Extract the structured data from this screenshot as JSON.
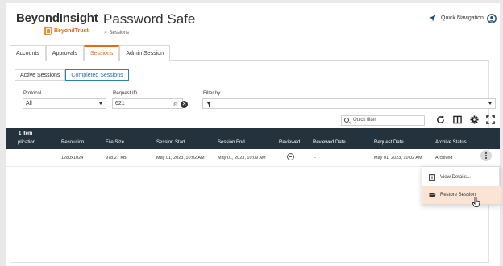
{
  "header": {
    "brand": "BeyondInsight",
    "brand_sub": "BeyondTrust",
    "app_title": "Password Safe",
    "breadcrumb_arrow": ">",
    "breadcrumb": "Sessions",
    "quick_nav": "Quick Navigation"
  },
  "tabs": [
    {
      "label": "Accounts",
      "active": false
    },
    {
      "label": "Approvals",
      "active": false
    },
    {
      "label": "Sessions",
      "active": true
    },
    {
      "label": "Admin Session",
      "active": false
    }
  ],
  "subtabs": [
    {
      "label": "Active Sessions",
      "active": false
    },
    {
      "label": "Completed Sessions",
      "active": true
    }
  ],
  "filters": {
    "protocol_label": "Protocol",
    "protocol_value": "All",
    "request_id_label": "Request ID",
    "request_id_value": "621",
    "filter_by_label": "Filter by"
  },
  "toolbar": {
    "quick_filter_placeholder": "Quick filter"
  },
  "grid": {
    "count": "1 item",
    "columns": [
      "plication",
      "Resolution",
      "File Size",
      "Session Start",
      "Session End",
      "Reviewed",
      "Reviewed Date",
      "Request Date",
      "Archive Status"
    ],
    "row": {
      "resolution": "1280x1024",
      "file_size": "978.27 KB",
      "session_start": "May 01, 2023, 10:02 AM",
      "session_end": "May 01, 2023, 10:09 AM",
      "reviewed_date": "-",
      "request_date": "May 01, 2023, 10:02 AM",
      "archive_status": "Archived"
    }
  },
  "context_menu": {
    "view_details": "View Details...",
    "restore_session": "Restore Session"
  },
  "colors": {
    "accent": "#e0691a",
    "grid_header": "#24323d",
    "nav_icon": "#1f4e79",
    "menu_hover": "#fbe4d4"
  }
}
